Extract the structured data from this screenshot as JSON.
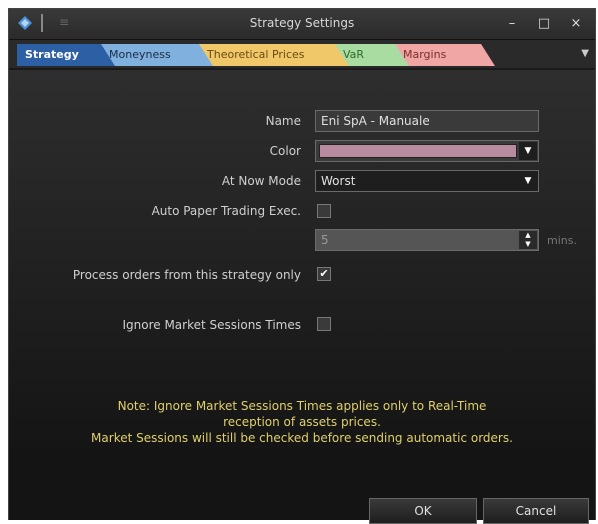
{
  "window": {
    "title": "Strategy Settings"
  },
  "titlebar": {
    "minimize": "–",
    "maximize": "□",
    "close": "×"
  },
  "tabs": [
    {
      "label": "Strategy"
    },
    {
      "label": "Moneyness"
    },
    {
      "label": "Theoretical Prices"
    },
    {
      "label": "VaR"
    },
    {
      "label": "Margins"
    }
  ],
  "form": {
    "name_label": "Name",
    "name_value": "Eni SpA - Manuale",
    "color_label": "Color",
    "color_value": "#b88c9e",
    "at_now_mode_label": "At Now Mode",
    "at_now_mode_value": "Worst",
    "auto_paper_label": "Auto Paper Trading Exec.",
    "auto_paper_checked": false,
    "mins_value": "5",
    "mins_unit": "mins.",
    "process_orders_label": "Process orders from this strategy only",
    "process_orders_checked": true,
    "ignore_sessions_label": "Ignore Market Sessions Times",
    "ignore_sessions_checked": false
  },
  "note": {
    "line1": "Note: Ignore Market Sessions Times applies only to Real-Time",
    "line2": "reception of assets prices.",
    "line3": "Market Sessions will still be checked before sending automatic orders."
  },
  "buttons": {
    "ok": "OK",
    "cancel": "Cancel"
  },
  "icons": {
    "app": "app-logo-icon",
    "pin": "pin-icon",
    "dropdown": "chevron-down-icon",
    "check": "checkmark-icon"
  }
}
